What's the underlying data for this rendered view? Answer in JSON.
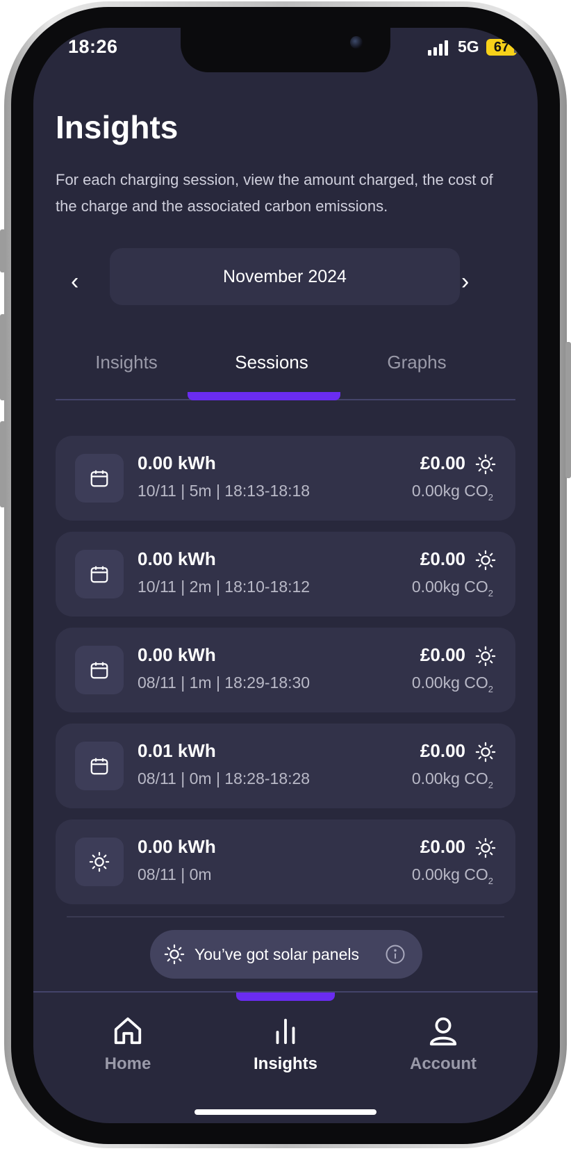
{
  "status_bar": {
    "time": "18:26",
    "network": "5G",
    "battery": "67"
  },
  "header": {
    "title": "Insights",
    "description": "For each charging session, view the amount charged, the cost of the charge and the associated carbon emissions."
  },
  "month_selector": {
    "label": "November 2024",
    "prev": "‹",
    "next": "›"
  },
  "tabs": [
    {
      "label": "Insights",
      "active": false
    },
    {
      "label": "Sessions",
      "active": true
    },
    {
      "label": "Graphs",
      "active": false
    }
  ],
  "sessions": [
    {
      "icon": "calendar-icon",
      "kwh": "0.00 kWh",
      "meta": "10/11 | 5m | 18:13-18:18",
      "cost": "£0.00",
      "co2": "0.00kg CO",
      "co2_sub": "2"
    },
    {
      "icon": "calendar-icon",
      "kwh": "0.00 kWh",
      "meta": "10/11 | 2m | 18:10-18:12",
      "cost": "£0.00",
      "co2": "0.00kg CO",
      "co2_sub": "2"
    },
    {
      "icon": "calendar-icon",
      "kwh": "0.00 kWh",
      "meta": "08/11 | 1m | 18:29-18:30",
      "cost": "£0.00",
      "co2": "0.00kg CO",
      "co2_sub": "2"
    },
    {
      "icon": "calendar-icon",
      "kwh": "0.01 kWh",
      "meta": "08/11 | 0m | 18:28-18:28",
      "cost": "£0.00",
      "co2": "0.00kg CO",
      "co2_sub": "2"
    },
    {
      "icon": "sun-icon",
      "kwh": "0.00 kWh",
      "meta": "08/11 | 0m",
      "cost": "£0.00",
      "co2": "0.00kg CO",
      "co2_sub": "2"
    }
  ],
  "solar_banner": {
    "text": "You’ve got solar panels"
  },
  "bottom_nav": [
    {
      "label": "Home",
      "icon": "home-icon",
      "active": false
    },
    {
      "label": "Insights",
      "icon": "bar-chart-icon",
      "active": true
    },
    {
      "label": "Account",
      "icon": "user-icon",
      "active": false
    }
  ],
  "colors": {
    "background": "#28283c",
    "card": "#323249",
    "accent": "#6a2cf0",
    "battery": "#f7d11a"
  }
}
